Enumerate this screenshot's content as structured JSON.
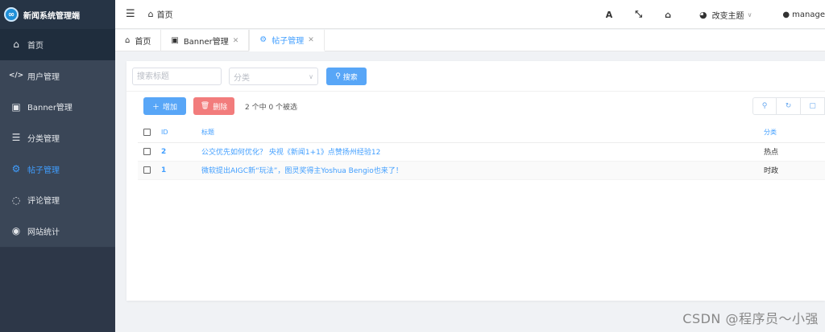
{
  "app": {
    "title": "新闻系统管理端",
    "logo_glyph": "∞"
  },
  "sidebar": {
    "items": [
      {
        "label": "首页",
        "icon": "home-icon",
        "glyph": "⌂"
      },
      {
        "label": "用户管理",
        "icon": "code-icon",
        "glyph": "</>"
      },
      {
        "label": "Banner管理",
        "icon": "image-icon",
        "glyph": "▣"
      },
      {
        "label": "分类管理",
        "icon": "list-icon",
        "glyph": "☰"
      },
      {
        "label": "帖子管理",
        "icon": "gear-icon",
        "glyph": "⚙"
      },
      {
        "label": "评论管理",
        "icon": "comments-icon",
        "glyph": "◌"
      },
      {
        "label": "网站统计",
        "icon": "globe-icon",
        "glyph": "◉"
      }
    ]
  },
  "header": {
    "breadcrumb_home": "首页",
    "font_glyph": "A",
    "fullscreen_glyph": "⤡",
    "home_glyph": "⌂",
    "theme_label": "改变主题",
    "user_label": "manage"
  },
  "tabs": [
    {
      "label": "首页",
      "icon": "home-icon",
      "glyph": "⌂",
      "closable": false
    },
    {
      "label": "Banner管理",
      "icon": "image-icon",
      "glyph": "▣",
      "closable": true
    },
    {
      "label": "帖子管理",
      "icon": "gear-icon",
      "glyph": "⚙",
      "closable": true,
      "active": true
    }
  ],
  "search": {
    "title_placeholder": "搜索标题",
    "category_placeholder": "分类",
    "search_label": "搜索"
  },
  "toolbar": {
    "add_label": "增加",
    "delete_label": "删除",
    "selection_info": "2 个中 0 个被选"
  },
  "table": {
    "headers": {
      "id": "ID",
      "title": "标题",
      "category": "分类"
    },
    "rows": [
      {
        "id": "2",
        "title": "公交优先如何优化？ 央视《新闻1+1》点赞扬州经验12",
        "category": "热点"
      },
      {
        "id": "1",
        "title": "微软提出AIGC新“玩法”，图灵奖得主Yoshua Bengio也来了！",
        "category": "时政"
      }
    ]
  },
  "watermark": "CSDN @程序员～小强",
  "colors": {
    "accent": "#409eff",
    "sidebar": "#2f3a4b",
    "danger": "#f27c7c"
  }
}
